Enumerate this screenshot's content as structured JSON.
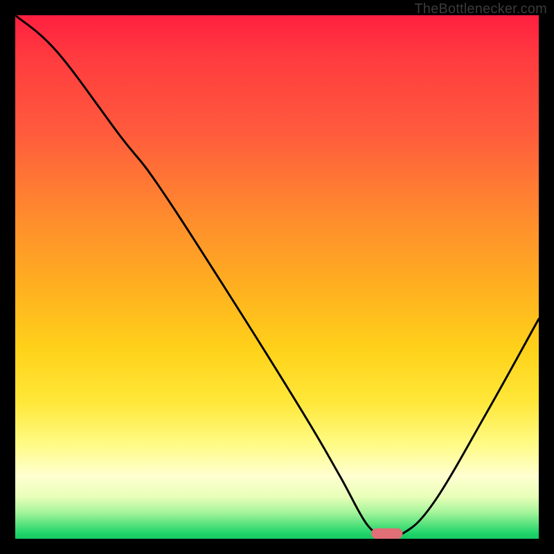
{
  "watermark": "TheBottlenecker.com",
  "chart_data": {
    "type": "line",
    "title": "",
    "xlabel": "",
    "ylabel": "",
    "xlim": [
      0,
      100
    ],
    "ylim": [
      0,
      100
    ],
    "grid": false,
    "legend": false,
    "background": {
      "type": "vertical-gradient",
      "stops": [
        {
          "pos": 0.0,
          "color": "#ff1f3f"
        },
        {
          "pos": 0.5,
          "color": "#ffc61a"
        },
        {
          "pos": 0.85,
          "color": "#fff79a"
        },
        {
          "pos": 1.0,
          "color": "#16c95f"
        }
      ]
    },
    "series": [
      {
        "name": "bottleneck-curve",
        "x": [
          0,
          8,
          20,
          27,
          40,
          55,
          62,
          67,
          70,
          74,
          80,
          90,
          100
        ],
        "values": [
          100,
          93,
          77,
          68,
          48,
          24,
          12,
          3,
          1,
          1,
          7,
          24,
          42
        ]
      }
    ],
    "marker": {
      "name": "optimal-point",
      "x": 71,
      "y": 1,
      "width": 6,
      "height": 2,
      "color": "#e06f77"
    }
  }
}
